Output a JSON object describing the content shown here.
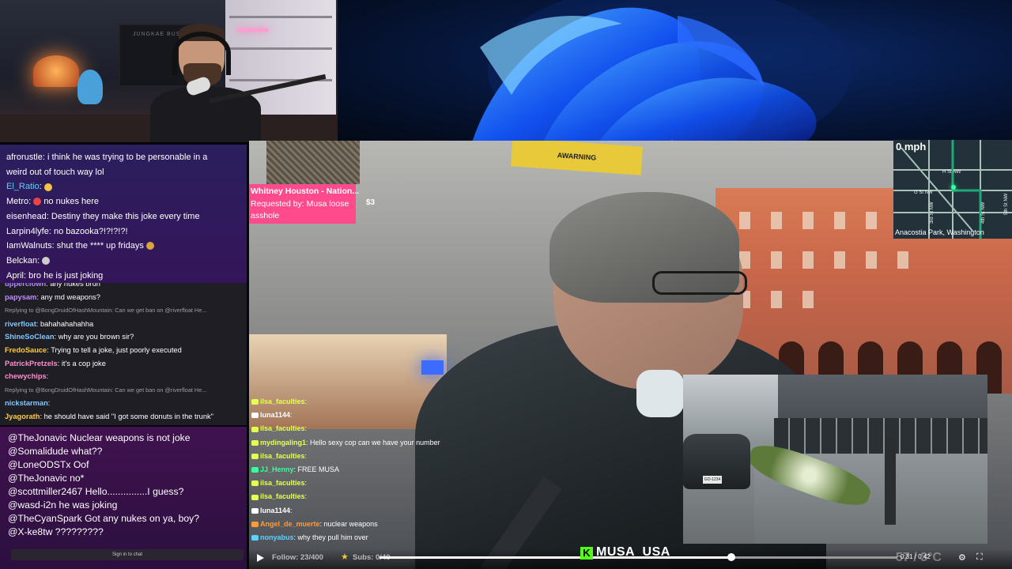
{
  "webcam": {
    "wall_text": "JUNGKAE BUSSE"
  },
  "chat_main": [
    {
      "user": "afrorustle",
      "text": "i think he was trying to be personable in a"
    },
    {
      "user": "",
      "text": "weird out of touch way lol"
    },
    {
      "user": "El_Ratio",
      "text": "",
      "user_color": "#5fd0ff"
    },
    {
      "user": "Metro",
      "text": "no nukes here"
    },
    {
      "user": "eisenhead",
      "text": "Destiny they make this joke every time"
    },
    {
      "user": "Larpin4lyfe",
      "text": "no bazooka?!?!?!?!"
    },
    {
      "user": "IamWalnuts",
      "text": "shut the **** up fridays"
    },
    {
      "user": "Belckan",
      "text": ""
    },
    {
      "user": "April",
      "text": "bro he is just joking"
    }
  ],
  "chat_mid": [
    {
      "type": "msg",
      "user": "upperclown",
      "text": "any nukes bruh",
      "color": "#b08cff"
    },
    {
      "type": "msg",
      "user": "papysam",
      "text": "any md weapons?",
      "color": "#c38bff"
    },
    {
      "type": "reply",
      "text": "Replying to @BongDruidOfHashMountain: Can we get ban on @riverfloat He..."
    },
    {
      "type": "msg",
      "user": "riverfloat",
      "text": "bahahahahahha",
      "color": "#7ec8ff"
    },
    {
      "type": "msg",
      "user": "ShineSoClean",
      "text": "why are you brown sir?",
      "color": "#7ec8ff"
    },
    {
      "type": "msg",
      "user": "FredoSauce",
      "text": "Trying to tell a joke, just poorly executed",
      "color": "#ffcc3a"
    },
    {
      "type": "msg",
      "user": "PatrickPretzels",
      "text": "it's a cop joke",
      "color": "#ff8cd1"
    },
    {
      "type": "msg",
      "user": "chewychips",
      "text": "",
      "color": "#ff8cd1"
    },
    {
      "type": "reply",
      "text": "Replying to @BongDruidOfHashMountain: Can we get ban on @riverfloat He..."
    },
    {
      "type": "msg",
      "user": "nickstarman",
      "text": "",
      "color": "#7ec8ff"
    },
    {
      "type": "msg",
      "user": "Jyagorath",
      "text": "he should have said \"I got some donuts in the trunk\"",
      "color": "#ffcc3a"
    }
  ],
  "chat_low": [
    {
      "user": "@TheJonavic",
      "text": "Nuclear weapons is not joke"
    },
    {
      "user": "@Somalidude",
      "text": "what??"
    },
    {
      "user": "@LoneODSTx",
      "text": "Oof"
    },
    {
      "user": "@TheJonavic",
      "text": "no*"
    },
    {
      "user": "@scottmiller2467",
      "text": "Hello...............I guess?"
    },
    {
      "user": "@wasd-i2n",
      "text": "he was joking"
    },
    {
      "user": "@TheCyanSpark",
      "text": "Got any nukes on ya, boy?"
    },
    {
      "user": "@X-ke8tw",
      "text": "?????????"
    }
  ],
  "signin_label": "Sign in to chat",
  "song": {
    "title": "Whitney Houston - Nation...",
    "requested": "Requested by: Musa loose",
    "requested2": "asshole",
    "price": "$3"
  },
  "video": {
    "warning": "AWARNING"
  },
  "overlay_chat": [
    {
      "user": "ilsa_faculties",
      "text": "",
      "color": "#e6ff55"
    },
    {
      "user": "luna1144",
      "text": "",
      "color": "#ffffff"
    },
    {
      "user": "ilsa_faculties",
      "text": "",
      "color": "#e6ff55"
    },
    {
      "user": "mydingaling1",
      "text": "Hello sexy cop can we have your number",
      "color": "#e6ff55"
    },
    {
      "user": "ilsa_faculties",
      "text": "",
      "color": "#e6ff55"
    },
    {
      "user": "JJ_Henny",
      "text": "FREE MUSA",
      "color": "#39ff9c"
    },
    {
      "user": "ilsa_faculties",
      "text": "",
      "color": "#e6ff55"
    },
    {
      "user": "ilsa_faculties",
      "text": "",
      "color": "#e6ff55"
    },
    {
      "user": "luna1144",
      "text": "",
      "color": "#ffffff"
    },
    {
      "user": "Angel_de_muerte",
      "text": "nuclear weapons",
      "color": "#ff9b3a"
    },
    {
      "user": "nonyabus",
      "text": "why they pull him over",
      "color": "#5fd0ff"
    }
  ],
  "map": {
    "speed": "0 mph",
    "location": "Anacostia Park, Washington",
    "streets": [
      "H St NW",
      "G St NW",
      "3rd St NW",
      "5th St NW",
      "4th St NW"
    ]
  },
  "pip": {
    "plate": "GO-1234"
  },
  "controls": {
    "follow": "Follow: 23/400",
    "subs": "Subs: 0/40",
    "timecode": "0:31 / 0:42",
    "channel": "MUSA_USA",
    "ghost_right": "57 / 3°C"
  },
  "progress_fraction": 0.68
}
